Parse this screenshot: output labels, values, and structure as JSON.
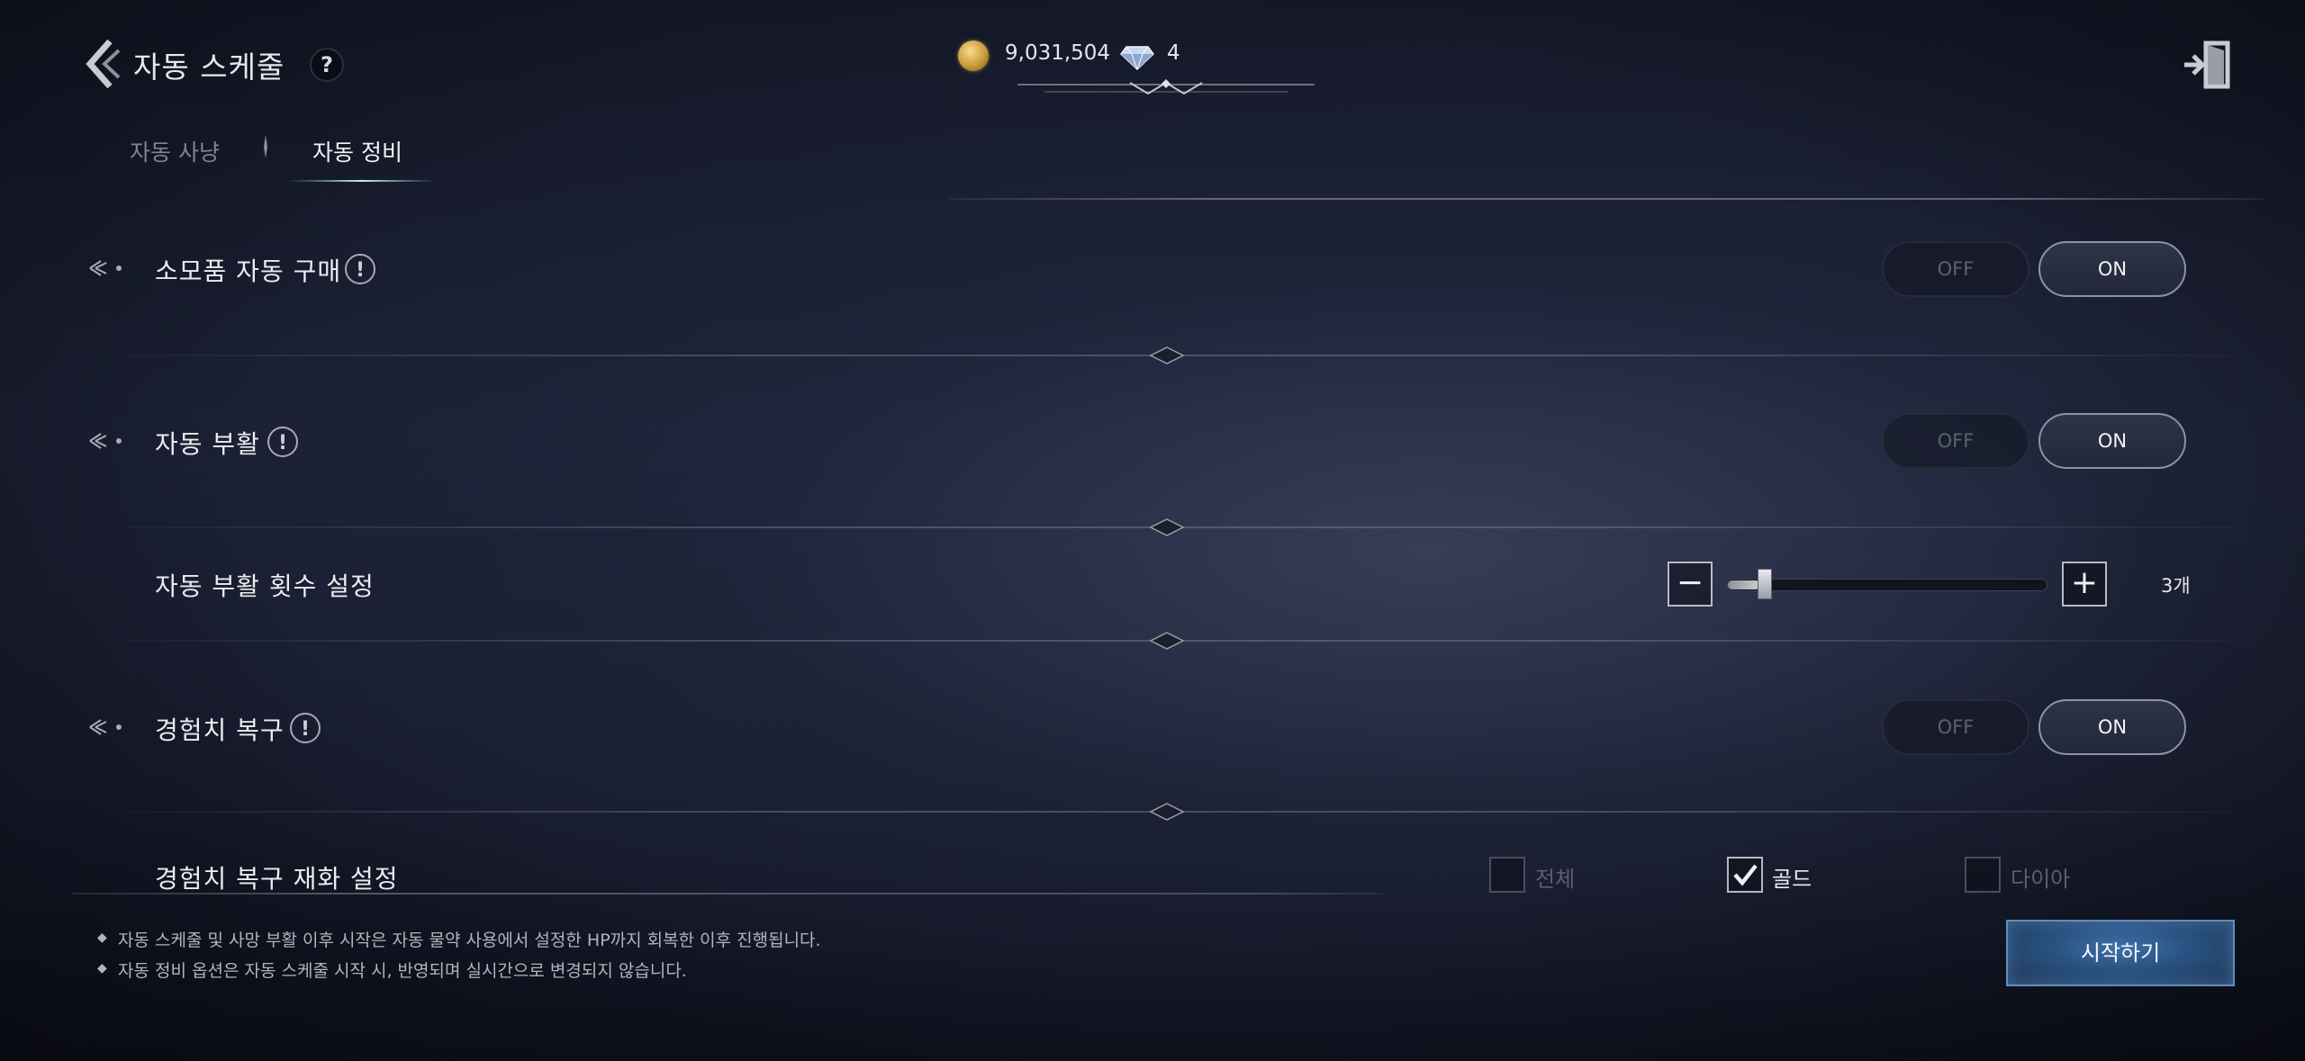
{
  "header": {
    "title": "자동 스케줄",
    "help_symbol": "?",
    "gold_amount": "9,031,504",
    "gem_amount": "4",
    "icons": [
      "back-arrow-icon",
      "help-icon",
      "gold-coin-icon",
      "diamond-icon",
      "exit-door-icon"
    ]
  },
  "tabs": [
    {
      "label": "자동 사냥",
      "active": false
    },
    {
      "label": "자동 정비",
      "active": true
    }
  ],
  "rows": [
    {
      "label": "소모품 자동 구매",
      "info_symbol": "!",
      "off_label": "OFF",
      "on_label": "ON",
      "value": "ON"
    },
    {
      "label": "자동 부활",
      "info_symbol": "!",
      "off_label": "OFF",
      "on_label": "ON",
      "value": "ON"
    },
    {
      "label": "자동 부활 횟수 설정",
      "minus": "−",
      "plus": "+",
      "count_label": "3개",
      "slider_fraction": 0.1
    },
    {
      "label": "경험치 복구",
      "info_symbol": "!",
      "off_label": "OFF",
      "on_label": "ON",
      "value": "ON"
    },
    {
      "label": "경험치 복구 재화 설정",
      "options": [
        {
          "label": "전체",
          "checked": false
        },
        {
          "label": "골드",
          "checked": true
        },
        {
          "label": "다이아",
          "checked": false
        }
      ]
    }
  ],
  "notes": [
    "자동 스케줄 및 사망 부활 이후 시작은 자동 물약 사용에서 설정한 HP까지 회복한 이후 진행됩니다.",
    "자동 정비 옵션은 자동 스케줄 시작 시, 반영되며 실시간으로 변경되지 않습니다."
  ],
  "start_button": "시작하기",
  "colors": {
    "background": "#15192a",
    "accent_blue": "#29517f",
    "text": "#ececf0"
  }
}
